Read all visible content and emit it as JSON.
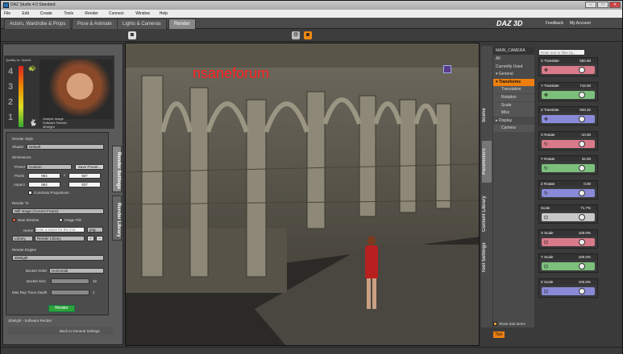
{
  "window": {
    "title": "DAZ Studio 4.0 Standard"
  },
  "menu": [
    "File",
    "Edit",
    "Create",
    "Tools",
    "Render",
    "Connect",
    "Window",
    "Help"
  ],
  "tabs": [
    {
      "label": "Actors, Wardrobe & Props"
    },
    {
      "label": "Pose & Animate"
    },
    {
      "label": "Lights & Cameras"
    },
    {
      "label": "Render"
    }
  ],
  "brand": "DAZ 3D",
  "header_links": {
    "feedback": "Feedback",
    "account": "My Account"
  },
  "left": {
    "quality_label": "Quality vs. Speed",
    "levels": [
      "4",
      "3",
      "2",
      "1"
    ],
    "preview_caption": "Sample Image\nSoftware Render\n3Delight",
    "render_style": "Render Style",
    "shader_label": "Shader",
    "shader_value": "Default",
    "dimensions": "Dimensions",
    "preset_label": "Preset",
    "preset_value": "Custom",
    "save_preset": "Save Preset...",
    "pixels_label": "Pixels",
    "pixels_w": "964",
    "pixels_h": "937",
    "aspect_label": "Aspect",
    "aspect_w": "964",
    "aspect_h": "937",
    "constrain": "Constrain Proportions",
    "render_to": "Render To",
    "render_to_value": "Still Image (Current Frame)",
    "new_window": "New Window",
    "image_file": "Image File",
    "name_label": "Name",
    "name_placeholder": "Enter a name for the ima",
    "ext": "png",
    "library": "Library",
    "render_library": "Render Library",
    "render_engine": "Render Engine",
    "engine_value": "3Delight",
    "bucket_order_label": "Bucket Order",
    "bucket_order_value": "Horizontal",
    "bucket_size_label": "Bucket Size",
    "bucket_size_value": "16",
    "max_ray_label": "Max Ray Trace Depth",
    "max_ray_value": "2",
    "render_button": "Render",
    "status": "3Delight - Software Render",
    "back": "Back to General Settings",
    "vtab_render_settings": "Render Settings",
    "vtab_render_library": "Render Library"
  },
  "viewport": {
    "watermark": "nsaneforum"
  },
  "right": {
    "camera": "MAIN_CAMERA",
    "filter_placeholder": "Enter text to filter by...",
    "tree": [
      {
        "label": "All",
        "sub": false,
        "hi": false
      },
      {
        "label": "Currently Used",
        "sub": false,
        "hi": false
      },
      {
        "label": "▾ General",
        "sub": false,
        "hi": false
      },
      {
        "label": "▾ Transforms",
        "sub": false,
        "hi": true
      },
      {
        "label": "Translation",
        "sub": true,
        "hi": false
      },
      {
        "label": "Rotation",
        "sub": true,
        "hi": false
      },
      {
        "label": "Scale",
        "sub": true,
        "hi": false
      },
      {
        "label": "Misc",
        "sub": true,
        "hi": false
      },
      {
        "label": "▸ Display",
        "sub": false,
        "hi": false
      },
      {
        "label": "Camera",
        "sub": true,
        "hi": false
      }
    ],
    "params": [
      {
        "name": "X Translate",
        "value": "582.60",
        "color": "#d97a8a",
        "icon": "✥",
        "knob": 0.8
      },
      {
        "name": "Y Translate",
        "value": "715.00",
        "color": "#7cc07c",
        "icon": "✥",
        "knob": 0.8
      },
      {
        "name": "Z Translate",
        "value": "933.32",
        "color": "#8a8ad8",
        "icon": "✥",
        "knob": 0.8
      },
      {
        "name": "X Rotate",
        "value": "-10.00",
        "color": "#d97a8a",
        "icon": "↻",
        "knob": 0.8
      },
      {
        "name": "Y Rotate",
        "value": "32.00",
        "color": "#7cc07c",
        "icon": "↻",
        "knob": 0.8
      },
      {
        "name": "Z Rotate",
        "value": "0.00",
        "color": "#8a8ad8",
        "icon": "↻",
        "knob": 0.8
      },
      {
        "name": "Scale",
        "value": "71.7%",
        "color": "#c8c8c8",
        "icon": "⊡",
        "knob": 0.8
      },
      {
        "name": "X Scale",
        "value": "100.0%",
        "color": "#d97a8a",
        "icon": "⊡",
        "knob": 0.8
      },
      {
        "name": "Y Scale",
        "value": "100.0%",
        "color": "#7cc07c",
        "icon": "⊡",
        "knob": 0.8
      },
      {
        "name": "Z Scale",
        "value": "100.0%",
        "color": "#8a8ad8",
        "icon": "⊡",
        "knob": 0.8
      }
    ],
    "vtabs": [
      "Scene",
      "Parameters",
      "Content Library",
      "Tool Settings"
    ],
    "show_sub": "Show Sub Items",
    "tips": "Tips"
  }
}
